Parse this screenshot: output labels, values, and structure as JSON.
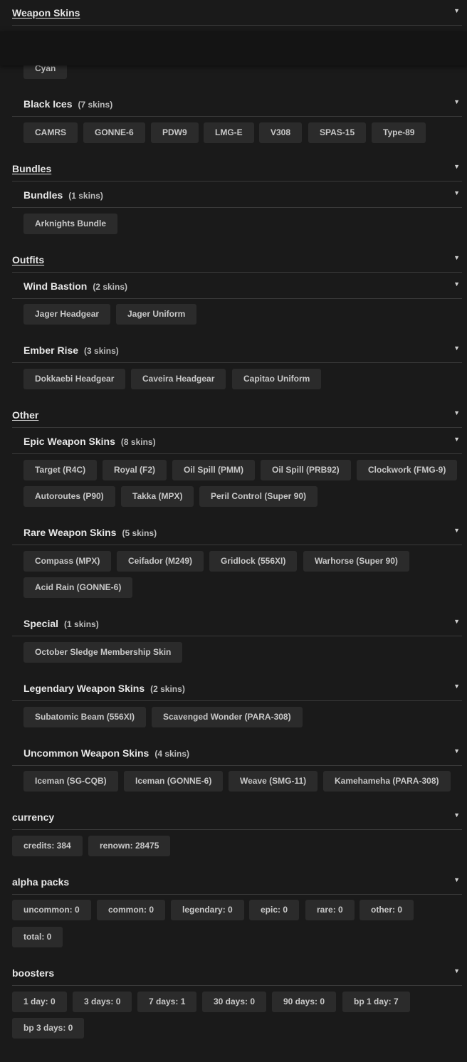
{
  "sections": {
    "weapon_skins": "Weapon Skins",
    "bundles": "Bundles",
    "outfits": "Outfits",
    "other": "Other",
    "currency": "currency",
    "alpha_packs": "alpha packs",
    "boosters": "boosters"
  },
  "groups": {
    "black_ices": {
      "title": "Black Ices",
      "count": "(7 skins)",
      "items": [
        "CAMRS",
        "GONNE-6",
        "PDW9",
        "LMG-E",
        "V308",
        "SPAS-15",
        "Type-89"
      ]
    },
    "bundles": {
      "title": "Bundles",
      "count": "(1 skins)",
      "items": [
        "Arknights Bundle"
      ]
    },
    "wind_bastion": {
      "title": "Wind Bastion",
      "count": "(2 skins)",
      "items": [
        "Jager Headgear",
        "Jager Uniform"
      ]
    },
    "ember_rise": {
      "title": "Ember Rise",
      "count": "(3 skins)",
      "items": [
        "Dokkaebi Headgear",
        "Caveira Headgear",
        "Capitao Uniform"
      ]
    },
    "epic": {
      "title": "Epic Weapon Skins",
      "count": "(8 skins)",
      "items": [
        "Target (R4C)",
        "Royal (F2)",
        "Oil Spill (PMM)",
        "Oil Spill (PRB92)",
        "Clockwork (FMG-9)",
        "Autoroutes (P90)",
        "Takka (MPX)",
        "Peril Control (Super 90)"
      ]
    },
    "rare": {
      "title": "Rare Weapon Skins",
      "count": "(5 skins)",
      "items": [
        "Compass (MPX)",
        "Ceifador (M249)",
        "Gridlock (556XI)",
        "Warhorse (Super 90)",
        "Acid Rain (GONNE-6)"
      ]
    },
    "special": {
      "title": "Special",
      "count": "(1 skins)",
      "items": [
        "October Sledge Membership Skin"
      ]
    },
    "legendary": {
      "title": "Legendary Weapon Skins",
      "count": "(2 skins)",
      "items": [
        "Subatomic Beam (556XI)",
        "Scavenged Wonder (PARA-308)"
      ]
    },
    "uncommon": {
      "title": "Uncommon Weapon Skins",
      "count": "(4 skins)",
      "items": [
        "Iceman (SG-CQB)",
        "Iceman (GONNE-6)",
        "Weave (SMG-11)",
        "Kamehameha (PARA-308)"
      ]
    }
  },
  "partial_item": "Cyan",
  "overlay_text": "",
  "currency": [
    "credits: 384",
    "renown: 28475"
  ],
  "alpha_packs": [
    "uncommon: 0",
    "common: 0",
    "legendary: 0",
    "epic: 0",
    "rare: 0",
    "other: 0",
    "total: 0"
  ],
  "boosters": [
    "1 day: 0",
    "3 days: 0",
    "7 days: 1",
    "30 days: 0",
    "90 days: 0",
    "bp 1 day: 7",
    "bp 3 days: 0"
  ],
  "caret_glyph": "▼"
}
